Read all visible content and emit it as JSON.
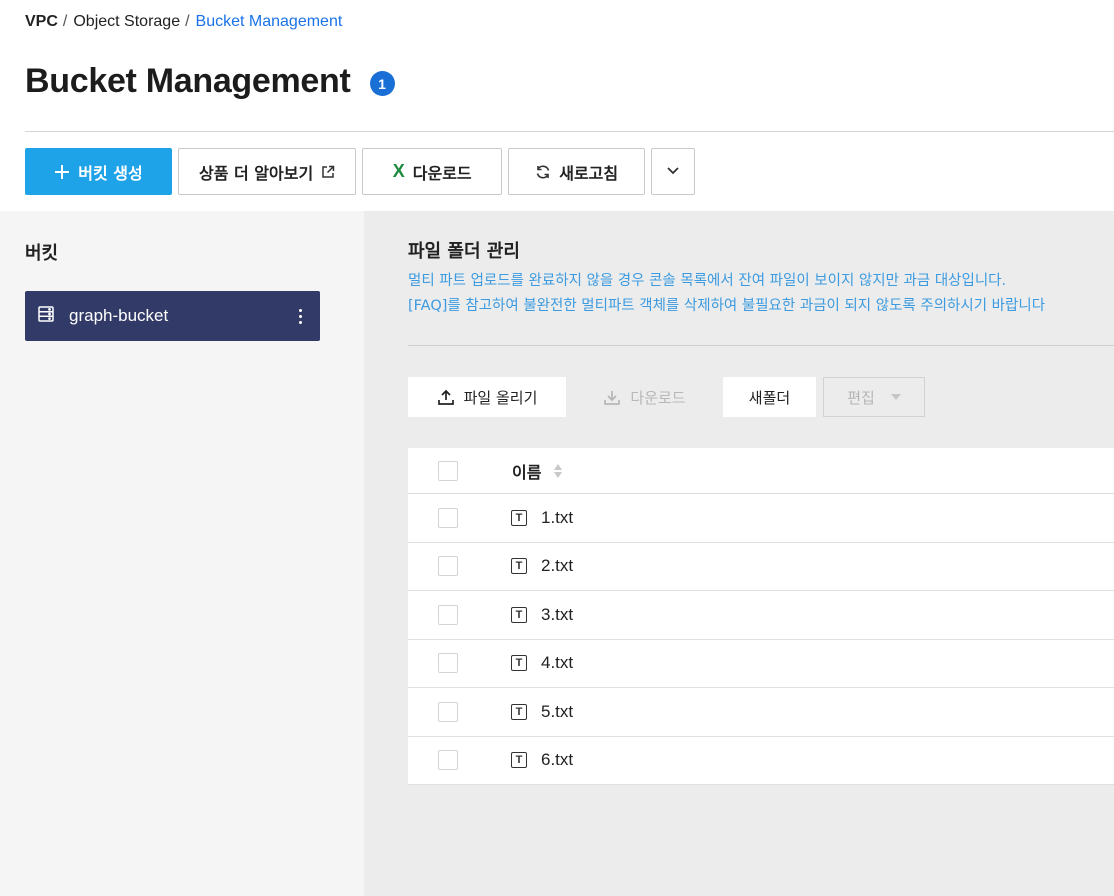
{
  "breadcrumb": {
    "items": [
      "VPC",
      "Object Storage"
    ],
    "separator": "/",
    "current": "Bucket Management"
  },
  "page": {
    "title": "Bucket Management",
    "help_badge": "1"
  },
  "toolbar": {
    "create_bucket_label": "버킷 생성",
    "learn_more_label": "상품 더 알아보기",
    "download_label": "다운로드",
    "refresh_label": "새로고침"
  },
  "sidebar": {
    "heading": "버킷",
    "buckets": [
      {
        "name": "graph-bucket",
        "selected": true
      }
    ]
  },
  "main": {
    "section_title": "파일 폴더 관리",
    "notice_lines": [
      "멀티 파트 업로드를 완료하지 않을 경우 콘솔 목록에서 잔여 파일이 보이지 않지만 과금 대상입니다.",
      "[FAQ]를 참고하여 불완전한 멀티파트 객체를 삭제하여 불필요한 과금이 되지 않도록 주의하시기 바랍니다"
    ],
    "actions": {
      "upload_label": "파일 올리기",
      "download_label": "다운로드",
      "new_folder_label": "새폴더",
      "edit_label": "편집"
    },
    "table": {
      "columns": [
        "이름"
      ],
      "rows": [
        {
          "name": "1.txt",
          "icon": "text-file-icon"
        },
        {
          "name": "2.txt",
          "icon": "text-file-icon"
        },
        {
          "name": "3.txt",
          "icon": "text-file-icon"
        },
        {
          "name": "4.txt",
          "icon": "text-file-icon"
        },
        {
          "name": "5.txt",
          "icon": "text-file-icon"
        },
        {
          "name": "6.txt",
          "icon": "text-file-icon"
        }
      ]
    }
  },
  "colors": {
    "primary_button": "#1ea2e8",
    "selected_bucket": "#323a67",
    "link_blue": "#1a73e8",
    "notice_blue": "#3c9be0",
    "excel_green": "#1e8a3e"
  }
}
